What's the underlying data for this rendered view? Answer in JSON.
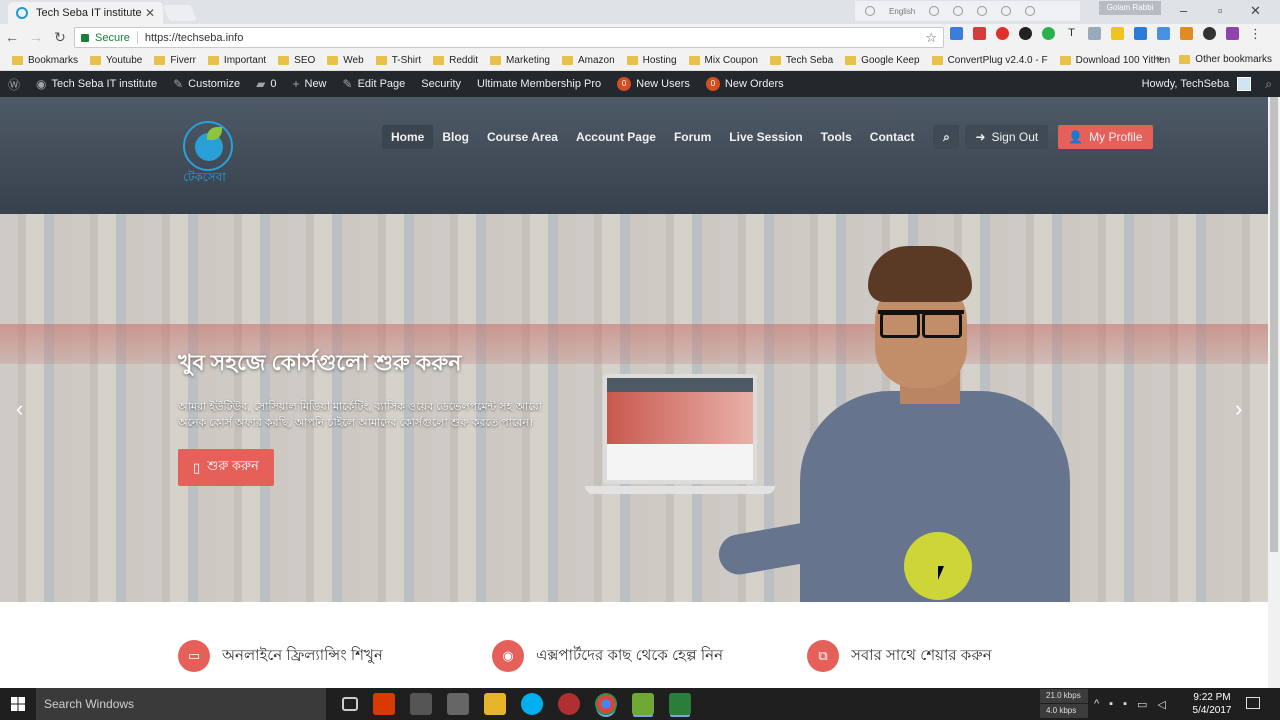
{
  "browser": {
    "tab_title": "Tech Seba IT institute",
    "tab_close": "✕",
    "ext_language": "English",
    "user_name": "Golam Rabbi",
    "secure_label": "Secure",
    "url": "https://techseba.info",
    "bookmarks": [
      "Bookmarks",
      "Youtube",
      "Fiverr",
      "Important",
      "SEO",
      "Web",
      "T-Shirt",
      "Reddit",
      "Marketing",
      "Amazon",
      "Hosting",
      "Mix Coupon",
      "Tech Seba",
      "Google Keep",
      "ConvertPlug v2.4.0 - F",
      "Download 100 Yithen"
    ],
    "bookmarks_more": "»",
    "other_bookmarks": "Other bookmarks"
  },
  "adminbar": {
    "site_name": "Tech Seba IT institute",
    "customize": "Customize",
    "comments_count": "0",
    "new": "New",
    "edit_page": "Edit Page",
    "security": "Security",
    "membership": "Ultimate Membership Pro",
    "new_users_count": "0",
    "new_users": "New Users",
    "new_orders_count": "0",
    "new_orders": "New Orders",
    "howdy": "Howdy, TechSeba"
  },
  "site": {
    "logo_text": "টেকসেবা",
    "nav": [
      "Home",
      "Blog",
      "Course Area",
      "Account Page",
      "Forum",
      "Live Session",
      "Tools",
      "Contact"
    ],
    "sign_out": "Sign Out",
    "my_profile": "My Profile"
  },
  "hero": {
    "title": "খুব সহজে কোর্সগুলো শুরু করুন",
    "description": "আমরা ইউটিউব, সোসিয়াল মিডিয়া মার্কেটিং, ব্যাসিক ওয়েব ডেভেলপমেন্ট সহ আরো অনেক কোর্স অফার করছি, আপনি চাইলে আমাদের কোর্সগুলো শুরু করতে পারেন।",
    "button": "শুরু করুন",
    "prev": "‹",
    "next": "›"
  },
  "features": [
    {
      "title": "অনলাইনে ফ্রিল্যান্সিং শিখুন",
      "icon": "monitor-icon"
    },
    {
      "title": "এক্সপার্টদের কাছ থেকে হেল্প নিন",
      "icon": "users-icon"
    },
    {
      "title": "সবার সাথে শেয়ার করুন",
      "icon": "share-icon"
    }
  ],
  "taskbar": {
    "search_placeholder": "Search Windows",
    "net_up": "21.0 kbps",
    "net_down": "4.0 kbps",
    "time": "9:22 PM",
    "date": "5/4/2017"
  },
  "colors": {
    "accent": "#e6605a",
    "header": "#3f4a55",
    "adminbar": "#23282d",
    "logo_blue": "#2aa0d8"
  }
}
